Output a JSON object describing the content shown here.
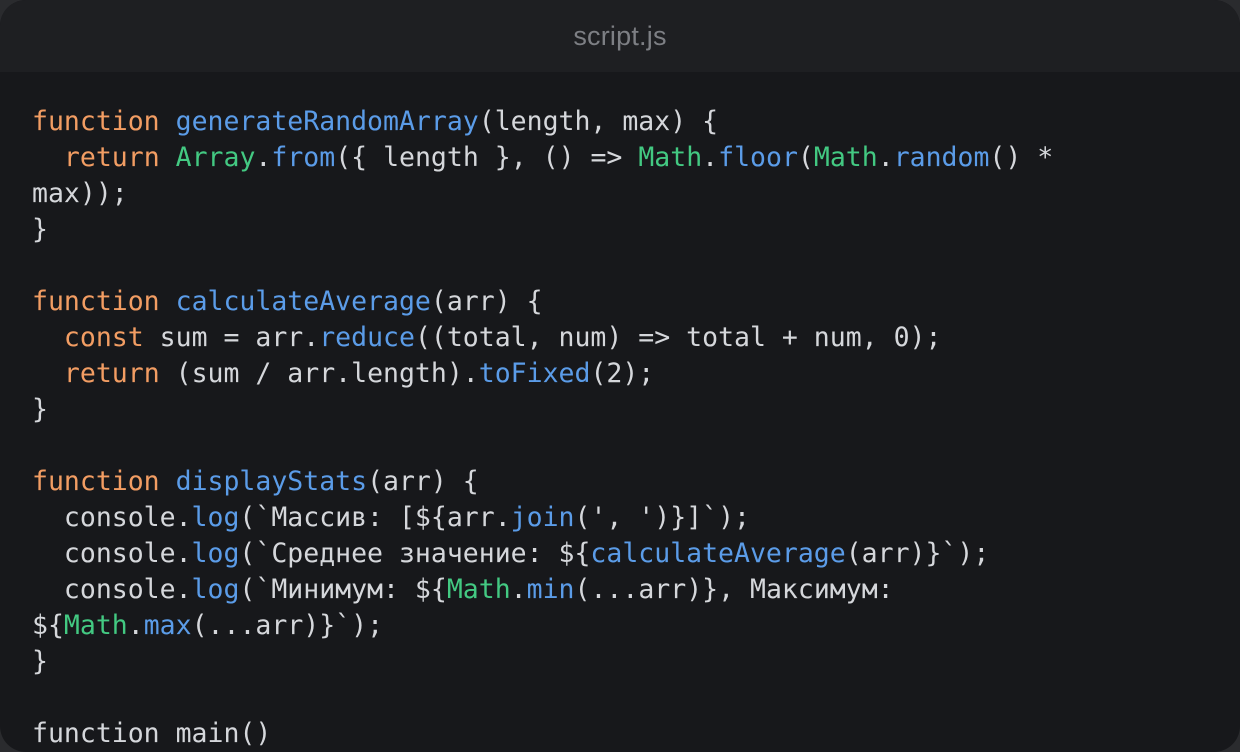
{
  "window": {
    "title": "script.js"
  },
  "colors": {
    "background": "#17181b",
    "titlebar": "#1e1f22",
    "title_text": "#7d7f84",
    "keyword": "#f29d63",
    "function": "#5b9ce8",
    "builtin": "#43c982",
    "text": "#d5d7db"
  },
  "code": {
    "lines": [
      [
        [
          "keyword",
          "function"
        ],
        [
          "plain",
          " "
        ],
        [
          "fn",
          "generateRandomArray"
        ],
        [
          "plain",
          "(length, max) {"
        ]
      ],
      [
        [
          "plain",
          "  "
        ],
        [
          "keyword",
          "return"
        ],
        [
          "plain",
          " "
        ],
        [
          "builtin",
          "Array"
        ],
        [
          "plain",
          "."
        ],
        [
          "fn",
          "from"
        ],
        [
          "plain",
          "({ length }, () => "
        ],
        [
          "builtin",
          "Math"
        ],
        [
          "plain",
          "."
        ],
        [
          "fn",
          "floor"
        ],
        [
          "plain",
          "("
        ],
        [
          "builtin",
          "Math"
        ],
        [
          "plain",
          "."
        ],
        [
          "fn",
          "random"
        ],
        [
          "plain",
          "() *"
        ]
      ],
      [
        [
          "plain",
          "max));"
        ]
      ],
      [
        [
          "plain",
          "}"
        ]
      ],
      [],
      [
        [
          "keyword",
          "function"
        ],
        [
          "plain",
          " "
        ],
        [
          "fn",
          "calculateAverage"
        ],
        [
          "plain",
          "(arr) {"
        ]
      ],
      [
        [
          "plain",
          "  "
        ],
        [
          "keyword",
          "const"
        ],
        [
          "plain",
          " sum = arr."
        ],
        [
          "fn",
          "reduce"
        ],
        [
          "plain",
          "((total, num) => total + num, 0);"
        ]
      ],
      [
        [
          "plain",
          "  "
        ],
        [
          "keyword",
          "return"
        ],
        [
          "plain",
          " (sum / arr.length)."
        ],
        [
          "fn",
          "toFixed"
        ],
        [
          "plain",
          "(2);"
        ]
      ],
      [
        [
          "plain",
          "}"
        ]
      ],
      [],
      [
        [
          "keyword",
          "function"
        ],
        [
          "plain",
          " "
        ],
        [
          "fn",
          "displayStats"
        ],
        [
          "plain",
          "(arr) {"
        ]
      ],
      [
        [
          "plain",
          "  console."
        ],
        [
          "fn",
          "log"
        ],
        [
          "plain",
          "(`Массив: [${arr."
        ],
        [
          "fn",
          "join"
        ],
        [
          "plain",
          "(', ')}]`);"
        ]
      ],
      [
        [
          "plain",
          "  console."
        ],
        [
          "fn",
          "log"
        ],
        [
          "plain",
          "(`Среднее значение: ${"
        ],
        [
          "fn",
          "calculateAverage"
        ],
        [
          "plain",
          "(arr)}`);"
        ]
      ],
      [
        [
          "plain",
          "  console."
        ],
        [
          "fn",
          "log"
        ],
        [
          "plain",
          "(`Минимум: ${"
        ],
        [
          "builtin",
          "Math"
        ],
        [
          "plain",
          "."
        ],
        [
          "fn",
          "min"
        ],
        [
          "plain",
          "(...arr)}, Максимум:"
        ]
      ],
      [
        [
          "plain",
          "${"
        ],
        [
          "builtin",
          "Math"
        ],
        [
          "plain",
          "."
        ],
        [
          "fn",
          "max"
        ],
        [
          "plain",
          "(...arr)}`);"
        ]
      ],
      [
        [
          "plain",
          "}"
        ]
      ],
      [],
      [
        [
          "plain",
          "function main()"
        ]
      ]
    ]
  }
}
